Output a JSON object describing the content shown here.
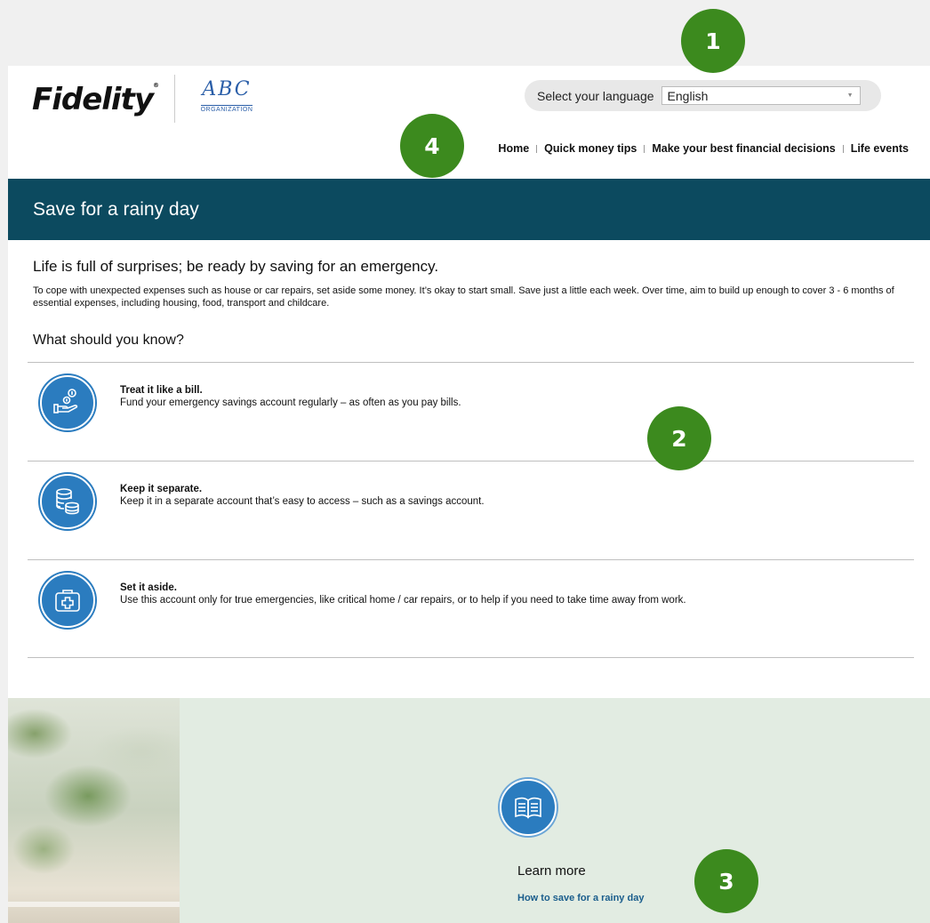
{
  "header": {
    "brand": "Fidelity",
    "brand_mark": "®",
    "partner_logo_text": "ABC",
    "partner_logo_sub": "ORGANIZATION",
    "language_label": "Select your language",
    "language_value": "English"
  },
  "nav": {
    "items": [
      "Home",
      "Quick money tips",
      "Make your best financial decisions",
      "Life events"
    ]
  },
  "banner": {
    "title": "Save for a rainy day"
  },
  "content": {
    "lead": "Life is full of surprises; be ready by saving for an emergency.",
    "intro": "To cope with unexpected expenses such as house or car repairs, set aside some money. It’s okay to start small. Save just a little each week. Over time, aim to build up enough to cover 3 - 6 months of essential expenses, including housing, food, transport and childcare.",
    "subhead": "What should you know?",
    "items": [
      {
        "title": "Treat it like a bill.",
        "text": "Fund your emergency savings account regularly – as often as you pay bills.",
        "icon": "hand-coins-icon"
      },
      {
        "title": "Keep it separate.",
        "text": "Keep it in a separate account that’s easy to access – such as a savings account.",
        "icon": "coin-stack-icon"
      },
      {
        "title": "Set it aside.",
        "text": "Use this account only for true emergencies, like critical home / car repairs, or to help if you need to take time away from work.",
        "icon": "first-aid-kit-icon"
      }
    ]
  },
  "promo": {
    "title": "Learn more",
    "link": "How to save for a rainy day",
    "icon": "open-book-icon"
  },
  "callouts": [
    "1",
    "2",
    "3",
    "4"
  ],
  "colors": {
    "banner": "#0c4a5f",
    "icon_blue": "#2b7cbf",
    "callout_green": "#3c8a1e",
    "promo_bg": "#e2ece2",
    "link": "#1a5d8c"
  }
}
